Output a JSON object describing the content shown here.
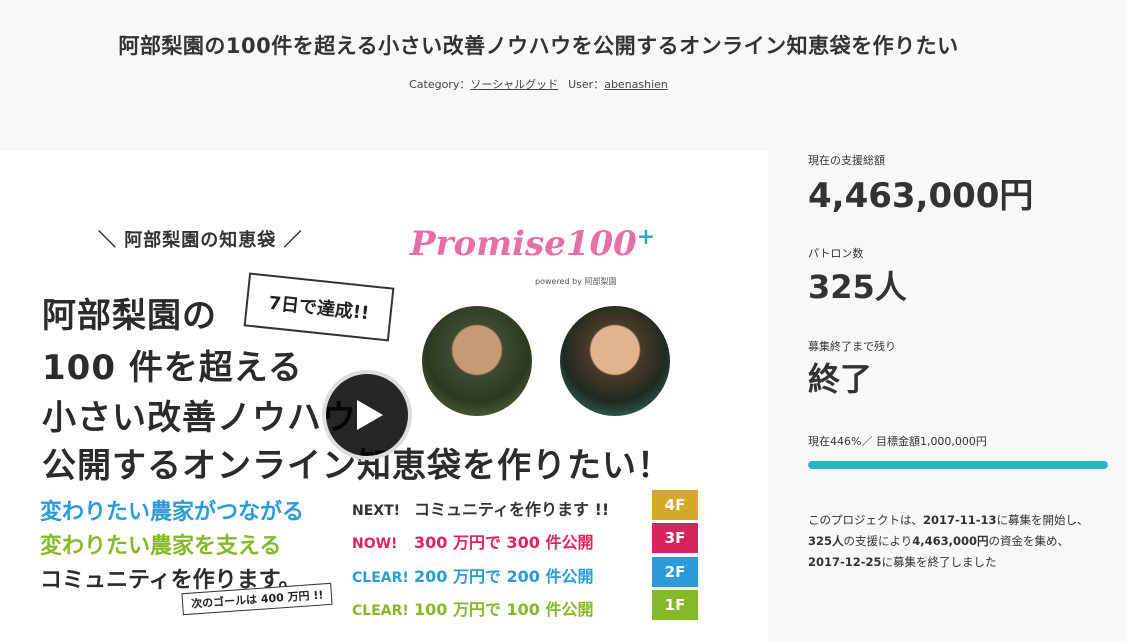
{
  "project": {
    "title": "阿部梨園の100件を超える小さい改善ノウハウを公開するオンライン知恵袋を作りたい",
    "category_label": "Category：",
    "category_value": "ソーシャルグッド",
    "user_label": "User：",
    "user_value": "abenashien"
  },
  "hero": {
    "badge_top": "＼ 阿部梨園の知恵袋 ／",
    "logo_text": "Promise100",
    "logo_plus": "+",
    "powered_by": "powered by 阿部梨園",
    "stamp": "7日で達成!!",
    "headline_lines": [
      "阿部梨園の",
      "100 件を超える",
      "小さい改善ノウハウ",
      "公開するオンライン知恵袋を作りたい！"
    ],
    "lead_lines": [
      "変わりたい農家がつながる",
      "変わりたい農家を支える",
      "コミュニティを作ります。"
    ],
    "goal_note": "次のゴールは 400 万円 !!",
    "stages": [
      {
        "tag": "NEXT!",
        "text": "コミュニティを作ります !!",
        "floor": "4F"
      },
      {
        "tag": "NOW!",
        "text": "300 万円で 300 件公開",
        "floor": "3F"
      },
      {
        "tag": "CLEAR!",
        "text": "200 万円で 200 件公開",
        "floor": "2F"
      },
      {
        "tag": "CLEAR!",
        "text": "100 万円で 100 件公開",
        "floor": "1F"
      }
    ],
    "colors": {
      "headline": "#2b2b2b",
      "lead1": "#2a9bd6",
      "lead2": "#86b92a",
      "lead3": "#2b2b2b",
      "next": "#333333",
      "now": "#e0245e",
      "clear2": "#2a9bd6",
      "clear1": "#86b92a",
      "floor4": "#d4a92a",
      "floor3": "#d6245c",
      "floor2": "#2a9bd6",
      "floor1": "#86b92a"
    }
  },
  "stats": {
    "total_label": "現在の支援総額",
    "total_value": "4,463,000円",
    "patrons_label": "パトロン数",
    "patrons_value": "325人",
    "remaining_label": "募集終了まで残り",
    "remaining_value": "終了",
    "progress_text": "現在446%／ 目標金額1,000,000円",
    "progress_percent": 100,
    "accent": "#2bb3c8"
  },
  "description": {
    "line1_a": "このプロジェクトは、",
    "start_date": "2017-11-13",
    "line1_b": "に募集を開始し、",
    "patrons": "325人",
    "line2_a": "の支援により",
    "amount": "4,463,000円",
    "line2_b": "の資金を集め、",
    "end_date": "2017-12-25",
    "line3_b": "に募集を終了しました"
  }
}
